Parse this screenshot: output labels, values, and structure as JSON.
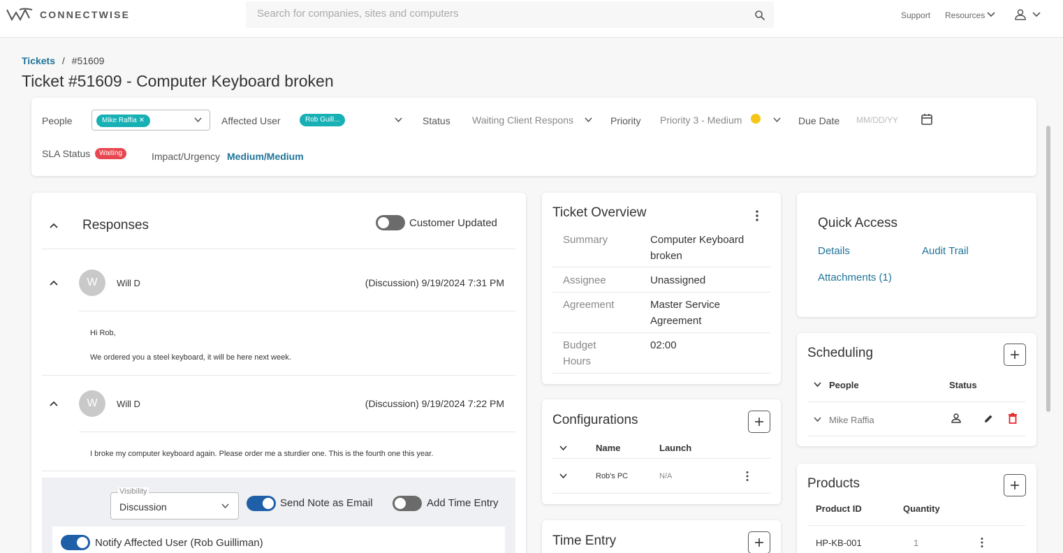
{
  "header": {
    "brand": "CONNECTWISE",
    "search_placeholder": "Search for companies, sites and computers",
    "support": "Support",
    "resources": "Resources"
  },
  "breadcrumb": {
    "root": "Tickets",
    "separator": "/",
    "current": "#51609"
  },
  "title": "Ticket #51609 - Computer Keyboard broken",
  "ticket_bar": {
    "people_label": "People",
    "people_value": "Mike Raffia",
    "affected_label": "Affected User",
    "affected_value": "Rob Guill...",
    "status_label": "Status",
    "status_value": "Waiting Client Respons",
    "priority_label": "Priority",
    "priority_value": "Priority 3 - Medium",
    "due_label": "Due Date",
    "due_placeholder": "MM/DD/YY",
    "sla_label": "SLA Status",
    "sla_value": "Waiting",
    "impact_label": "Impact/Urgency",
    "impact_value": "Medium/Medium"
  },
  "responses": {
    "title": "Responses",
    "customer_updated": "Customer Updated",
    "items": [
      {
        "initial": "W",
        "author": "Will D",
        "meta": "(Discussion) 9/19/2024 7:31 PM",
        "line1": "Hi Rob,",
        "line2": "We ordered you a steel keyboard, it will be here next week."
      },
      {
        "initial": "W",
        "author": "Will D",
        "meta": "(Discussion) 9/19/2024 7:22 PM",
        "line1": "I broke my computer keyboard again. Please order me a sturdier one. This is the fourth one this year."
      }
    ],
    "composer": {
      "visibility_label": "Visibility",
      "visibility_value": "Discussion",
      "send_email": "Send Note as Email",
      "add_time": "Add Time Entry",
      "notify": "Notify Affected User (Rob Guilliman)"
    }
  },
  "overview": {
    "title": "Ticket Overview",
    "rows": [
      {
        "key": "Summary",
        "value1": "Computer Keyboard",
        "value2": "broken"
      },
      {
        "key": "Assignee",
        "value1": "Unassigned"
      },
      {
        "key": "Agreement",
        "value1": "Master Service",
        "value2": "Agreement"
      },
      {
        "key1": "Budget",
        "key2": "Hours",
        "value1": "02:00"
      }
    ]
  },
  "configurations": {
    "title": "Configurations",
    "col_name": "Name",
    "col_launch": "Launch",
    "row_name": "Rob's PC",
    "row_launch": "N/A"
  },
  "time_entry": {
    "title": "Time Entry"
  },
  "quick_access": {
    "title": "Quick Access",
    "details": "Details",
    "audit": "Audit Trail",
    "attachments": "Attachments (1)"
  },
  "scheduling": {
    "title": "Scheduling",
    "col_people": "People",
    "col_status": "Status",
    "row_person": "Mike Raffia"
  },
  "products": {
    "title": "Products",
    "col_id": "Product ID",
    "col_qty": "Quantity",
    "row_id": "HP-KB-001",
    "row_qty": "1"
  },
  "colors": {
    "teal": "#17b0b5",
    "link": "#1f7399",
    "toggle_on": "#1f5fa8",
    "danger": "#e8474f",
    "priority_dot": "#f5c518"
  }
}
